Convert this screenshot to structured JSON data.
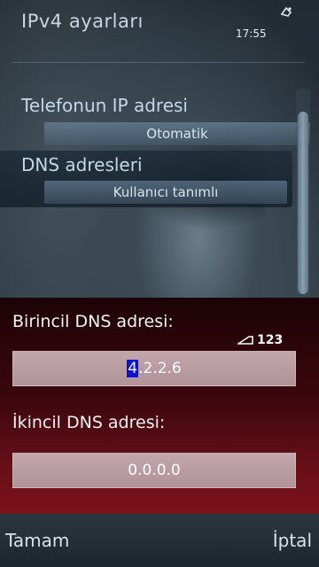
{
  "header": {
    "title": "IPv4 ayarları",
    "clock": "17:55"
  },
  "settings": [
    {
      "label": "Telefonun IP adresi",
      "value": "Otomatik"
    },
    {
      "label": "DNS adresleri",
      "value": "Kullanıcı tanımlı"
    }
  ],
  "dialog": {
    "input_mode": "123",
    "primary_dns": {
      "label": "Birincil DNS adresi:",
      "selected_char": "4",
      "rest": ".2.2.6"
    },
    "secondary_dns": {
      "label": "İkincil DNS adresi:",
      "value": "0.0.0.0"
    }
  },
  "softkeys": {
    "left": "Tamam",
    "right": "İptal"
  },
  "colors": {
    "cursor_highlight": "#0a12d8",
    "dialog_bg": "#3a070d"
  }
}
